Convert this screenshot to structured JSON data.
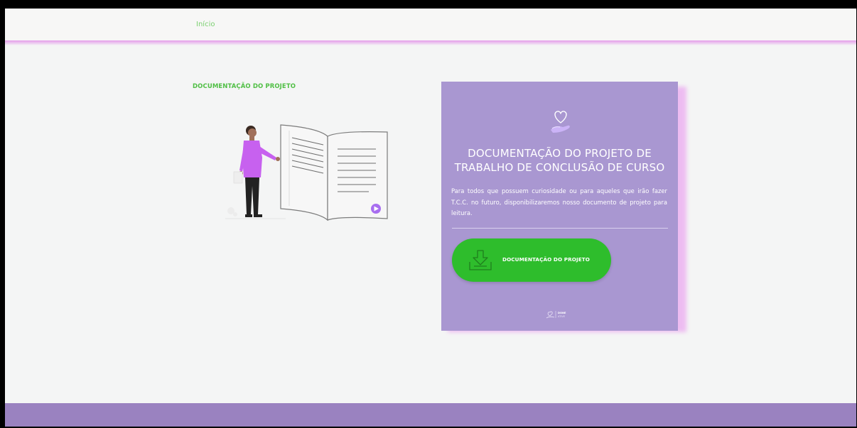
{
  "nav": {
    "home_label": "Início"
  },
  "section": {
    "title": "DOCUMENTAÇÃO DO PROJETO"
  },
  "card": {
    "heading_line1": "DOCUMENTAÇÃO DO PROJETO DE",
    "heading_line2": "TRABALHO DE CONCLUSÃO DE CURSO",
    "description": "Para todos que possuem curiosidade ou para aqueles que irão fazer T.C.C. no futuro, disponibilizaremos nosso documento de projeto para leitura.",
    "button_label": "DOCUMENTAÇÃO DO PROJETO",
    "logo_text": "DONE ATIVE"
  },
  "icons": {
    "card_icon": "heart-hand-icon",
    "button_icon": "download-icon",
    "illustration": "person-reading-book"
  },
  "colors": {
    "accent_green": "#2ebd2c",
    "card_purple": "#a997d1",
    "footer_purple": "#9a82c0",
    "nav_link_green": "#7ad06f",
    "pink_glow": "#e49cea"
  }
}
